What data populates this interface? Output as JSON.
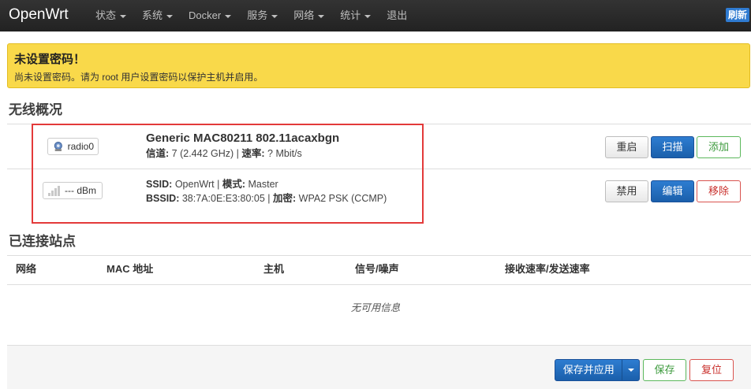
{
  "brand": "OpenWrt",
  "nav": {
    "items": [
      {
        "label": "状态",
        "dropdown": true
      },
      {
        "label": "系统",
        "dropdown": true
      },
      {
        "label": "Docker",
        "dropdown": true
      },
      {
        "label": "服务",
        "dropdown": true
      },
      {
        "label": "网络",
        "dropdown": true
      },
      {
        "label": "统计",
        "dropdown": true
      },
      {
        "label": "退出",
        "dropdown": false
      }
    ],
    "refresh_label": "刷新"
  },
  "alert": {
    "title": "未设置密码！",
    "text": "尚未设置密码。请为 root 用户设置密码以保护主机并启用。"
  },
  "wireless": {
    "title": "无线概况",
    "radio": {
      "badge": "radio0",
      "name": "Generic MAC80211 802.11acaxbgn",
      "channel_label": "信道:",
      "channel_value": "7 (2.442 GHz)",
      "rate_label": "速率:",
      "rate_value": "? Mbit/s",
      "buttons": {
        "restart": "重启",
        "scan": "扫描",
        "add": "添加"
      }
    },
    "network": {
      "badge": "--- dBm",
      "ssid_label": "SSID:",
      "ssid_value": "OpenWrt",
      "mode_label": "模式:",
      "mode_value": "Master",
      "bssid_label": "BSSID:",
      "bssid_value": "38:7A:0E:E3:80:05",
      "enc_label": "加密:",
      "enc_value": "WPA2 PSK (CCMP)",
      "buttons": {
        "disable": "禁用",
        "edit": "编辑",
        "remove": "移除"
      }
    }
  },
  "stations": {
    "title": "已连接站点",
    "columns": [
      "网络",
      "MAC 地址",
      "主机",
      "信号/噪声",
      "接收速率/发送速率"
    ],
    "empty_text": "无可用信息"
  },
  "footer": {
    "save_apply": "保存并应用",
    "save": "保存",
    "reset": "复位"
  },
  "colors": {
    "navbar": "#222222",
    "alert_bg": "#f9d94a",
    "primary": "#1a5fab",
    "success": "#5cb85c",
    "danger": "#d9534f",
    "highlight_box": "#e33a3a"
  }
}
